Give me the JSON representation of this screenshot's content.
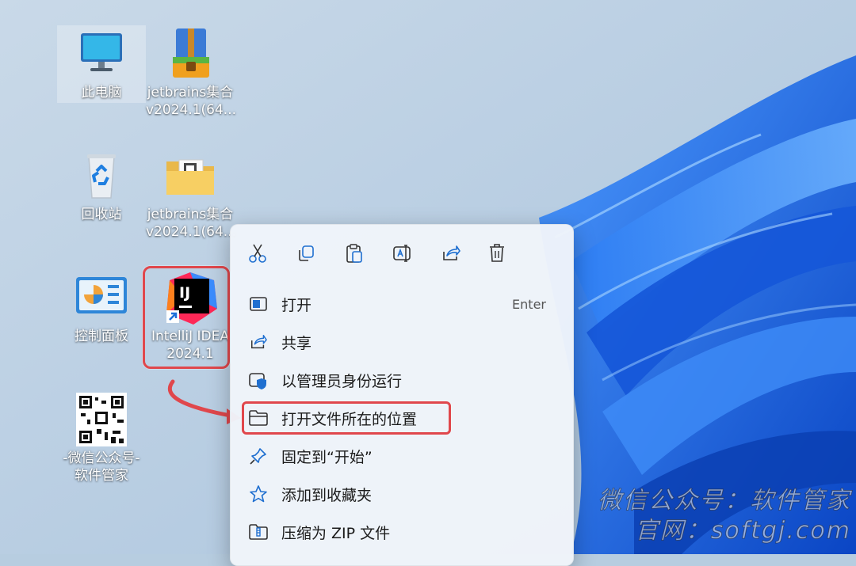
{
  "desktop": {
    "icons": [
      {
        "label": "此电脑",
        "icon": "monitor-icon"
      },
      {
        "label": "jetbrains集合",
        "label2": "v2024.1(64...",
        "icon": "zip-archive-icon"
      },
      {
        "label": "回收站",
        "icon": "recycle-bin-icon"
      },
      {
        "label": "jetbrains集合",
        "label2": "v2024.1(64...",
        "icon": "folder-icon"
      },
      {
        "label": "控制面板",
        "icon": "control-panel-icon"
      },
      {
        "label": "IntelliJ IDEA",
        "label2": "2024.1",
        "icon": "intellij-idea-icon",
        "logo_text": "IJ"
      },
      {
        "label": "-微信公众号-",
        "label2": "软件管家",
        "icon": "qr-code-icon"
      }
    ]
  },
  "context_menu": {
    "toolbar": [
      {
        "name": "cut",
        "icon": "scissors-icon"
      },
      {
        "name": "copy",
        "icon": "copy-icon"
      },
      {
        "name": "paste",
        "icon": "paste-icon"
      },
      {
        "name": "rename",
        "icon": "rename-icon"
      },
      {
        "name": "share",
        "icon": "share-icon"
      },
      {
        "name": "delete",
        "icon": "trash-icon"
      }
    ],
    "items": [
      {
        "label": "打开",
        "shortcut": "Enter",
        "icon": "open-icon"
      },
      {
        "label": "共享",
        "icon": "share-icon"
      },
      {
        "label": "以管理员身份运行",
        "icon": "shield-icon"
      },
      {
        "label": "打开文件所在的位置",
        "icon": "folder-outline-icon",
        "highlighted": true
      },
      {
        "label": "固定到“开始”",
        "icon": "pin-icon"
      },
      {
        "label": "添加到收藏夹",
        "icon": "star-icon"
      },
      {
        "label": "压缩为 ZIP 文件",
        "icon": "zip-folder-icon"
      }
    ]
  },
  "watermark": {
    "line1": "微信公众号：软件管家",
    "line2": "官网：softgj.com"
  },
  "colors": {
    "highlight": "#e0474c",
    "accent": "#0067c0",
    "wallpaper_blue": "#1f6fe8"
  }
}
